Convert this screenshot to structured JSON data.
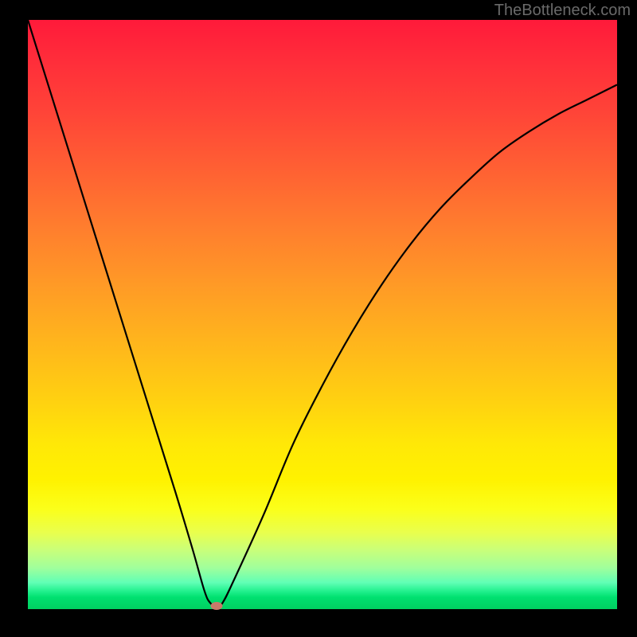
{
  "watermark": "TheBottleneck.com",
  "chart_data": {
    "type": "line",
    "title": "",
    "xlabel": "",
    "ylabel": "",
    "xlim": [
      0,
      100
    ],
    "ylim": [
      0,
      100
    ],
    "background_gradient": {
      "top": "#ff1a3a",
      "mid": "#ffe807",
      "bottom": "#00d060"
    },
    "series": [
      {
        "name": "bottleneck-curve",
        "x": [
          0,
          5,
          10,
          15,
          20,
          25,
          28,
          30,
          31,
          32,
          33,
          35,
          40,
          45,
          50,
          55,
          60,
          65,
          70,
          75,
          80,
          85,
          90,
          95,
          100
        ],
        "values": [
          100,
          84,
          68,
          52,
          36,
          20,
          10,
          3,
          1,
          0.5,
          1,
          5,
          16,
          28,
          38,
          47,
          55,
          62,
          68,
          73,
          77.5,
          81,
          84,
          86.5,
          89
        ]
      }
    ],
    "marker": {
      "name": "optimal-point",
      "x": 32,
      "y": 0.5,
      "color": "#c97a6a"
    }
  }
}
